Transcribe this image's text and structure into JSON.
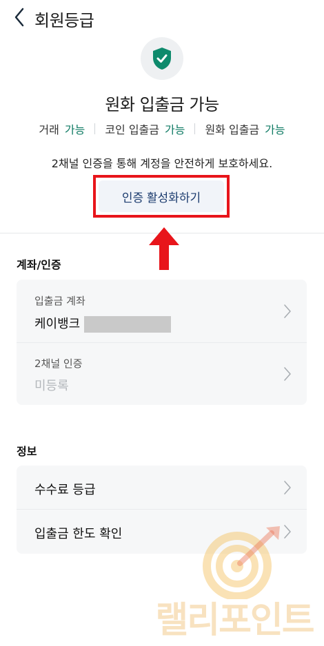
{
  "header": {
    "title": "회원등급"
  },
  "level": {
    "title": "원화 입출금 가능",
    "permissions": [
      {
        "label": "거래",
        "value": "가능"
      },
      {
        "label": "코인 입출금",
        "value": "가능"
      },
      {
        "label": "원화 입출금",
        "value": "가능"
      }
    ],
    "notice": "2채널 인증을 통해 계정을 안전하게 보호하세요.",
    "cta_label": "인증 활성화하기"
  },
  "account_section": {
    "title": "계좌/인증",
    "deposit_account": {
      "label": "입출금 계좌",
      "value": "케이뱅크"
    },
    "two_channel": {
      "label": "2채널 인증",
      "value": "미등록"
    }
  },
  "info_section": {
    "title": "정보",
    "items": [
      {
        "label": "수수료 등급"
      },
      {
        "label": "입출금 한도 확인"
      }
    ]
  },
  "watermark": {
    "text": "랠리포인트"
  },
  "colors": {
    "accent_green": "#0e7a63",
    "highlight_red": "#e8151b",
    "cta_text": "#1b3b6e"
  }
}
